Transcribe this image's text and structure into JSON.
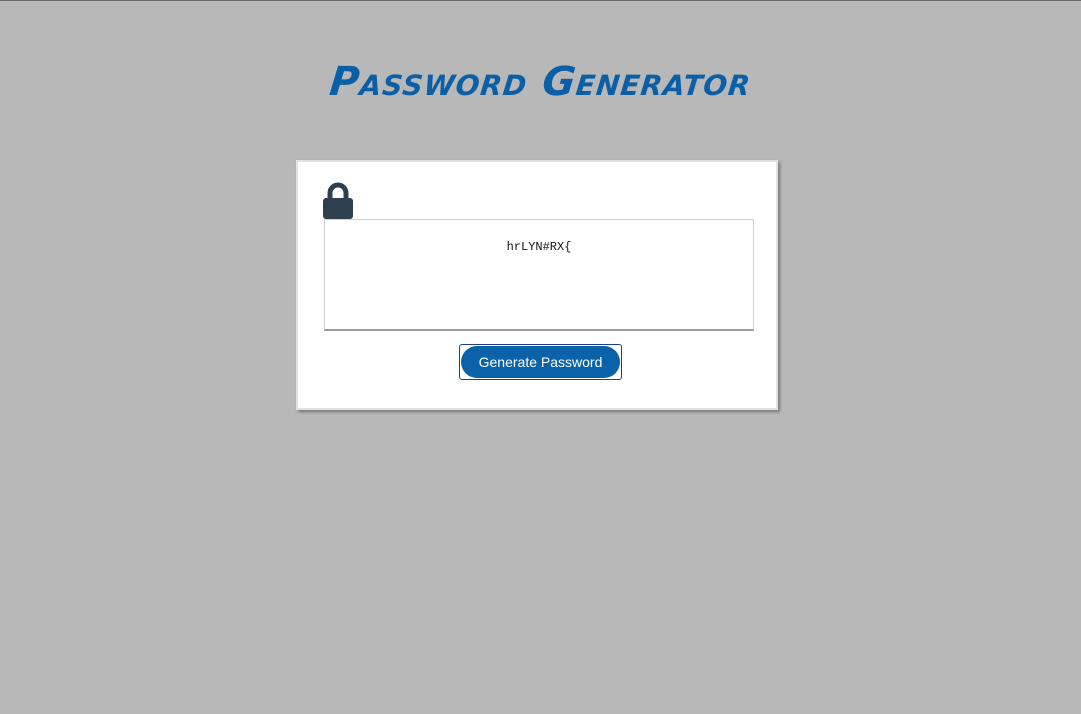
{
  "header": {
    "title": "Password Generator"
  },
  "card": {
    "icon": "lock-icon",
    "password_value": "hrLYN#RX{",
    "generate_label": "Generate Password"
  },
  "colors": {
    "background": "#b8b8b8",
    "title": "#0a5fa6",
    "button": "#0a63a8",
    "icon": "#2e3f4f"
  }
}
